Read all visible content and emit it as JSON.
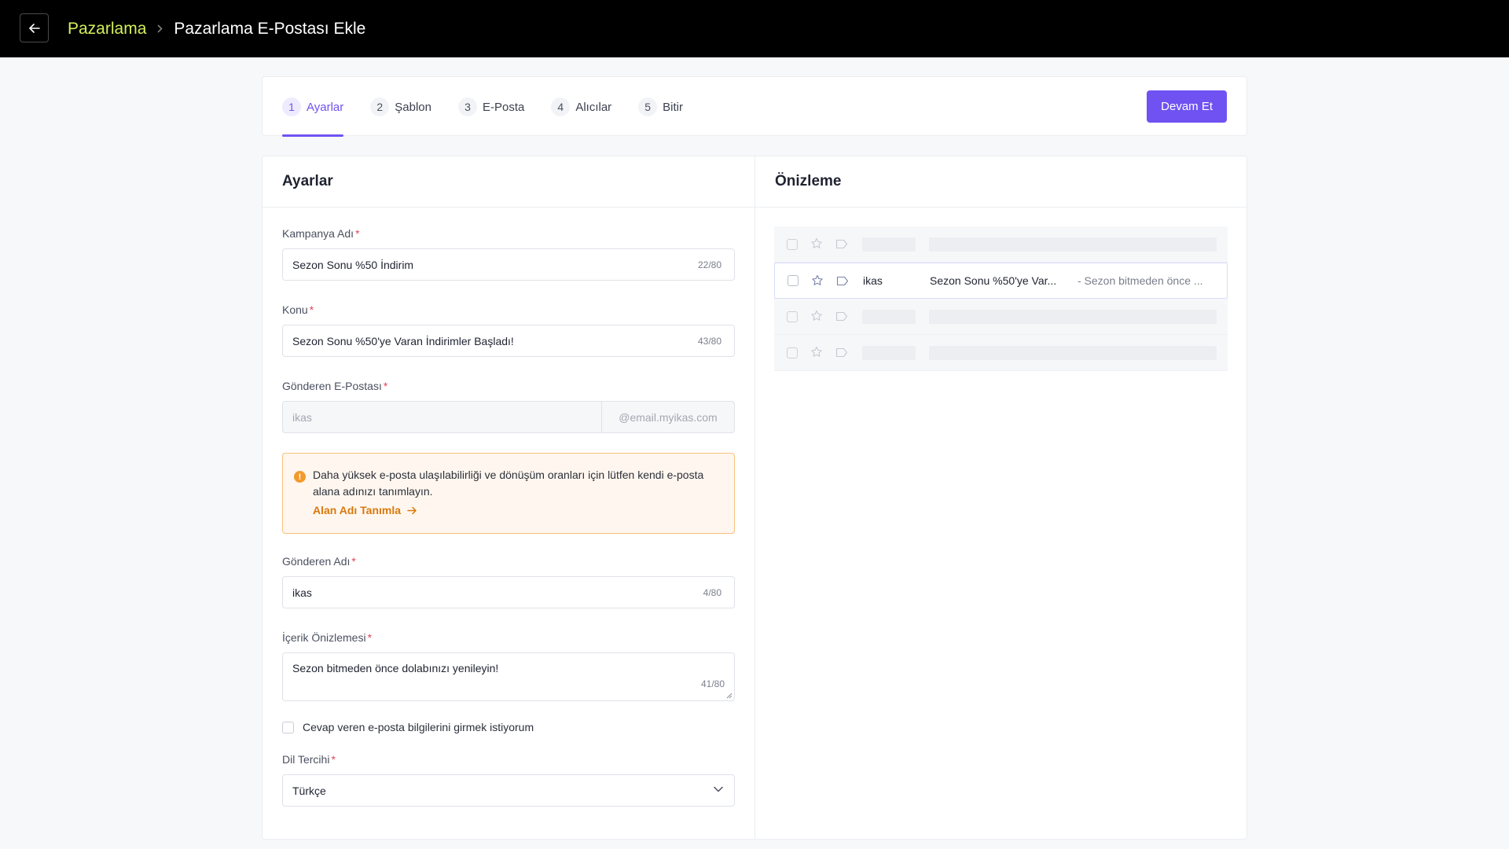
{
  "topbar": {
    "breadcrumb_parent": "Pazarlama",
    "breadcrumb_current": "Pazarlama E-Postası Ekle"
  },
  "stepper": {
    "steps": [
      {
        "num": "1",
        "label": "Ayarlar"
      },
      {
        "num": "2",
        "label": "Şablon"
      },
      {
        "num": "3",
        "label": "E-Posta"
      },
      {
        "num": "4",
        "label": "Alıcılar"
      },
      {
        "num": "5",
        "label": "Bitir"
      }
    ],
    "active_step": "Ayarlar",
    "continue_label": "Devam Et"
  },
  "settings": {
    "title": "Ayarlar",
    "campaign_name": {
      "label": "Kampanya Adı",
      "value": "Sezon Sonu %50 İndirim",
      "counter": "22/80"
    },
    "subject": {
      "label": "Konu",
      "value": "Sezon Sonu %50'ye Varan İndirimler Başladı!",
      "counter": "43/80"
    },
    "sender_email": {
      "label": "Gönderen E-Postası",
      "placeholder": "ikas",
      "domain": "@email.myikas.com"
    },
    "warning": {
      "text": "Daha yüksek e-posta ulaşılabilirliği ve dönüşüm oranları için lütfen kendi e-posta alana adınızı tanımlayın.",
      "link": "Alan Adı Tanımla"
    },
    "sender_name": {
      "label": "Gönderen Adı",
      "value": "ikas",
      "counter": "4/80"
    },
    "content_preview": {
      "label": "İçerik Önizlemesi",
      "value": "Sezon bitmeden önce dolabınızı yenileyin!",
      "counter": "41/80"
    },
    "reply_checkbox_label": "Cevap veren e-posta bilgilerini girmek istiyorum",
    "language": {
      "label": "Dil Tercihi",
      "value": "Türkçe"
    },
    "required_mark": "*"
  },
  "preview": {
    "title": "Önizleme",
    "email": {
      "sender": "ikas",
      "subject": "Sezon Sonu %50'ye Var...",
      "snippet": "- Sezon bitmeden önce ..."
    }
  },
  "colors": {
    "accent": "#7052f2",
    "breadcrumb_link": "#d4ef5a",
    "warning_bg": "#fff7ef",
    "warning_link": "#d9780e"
  }
}
